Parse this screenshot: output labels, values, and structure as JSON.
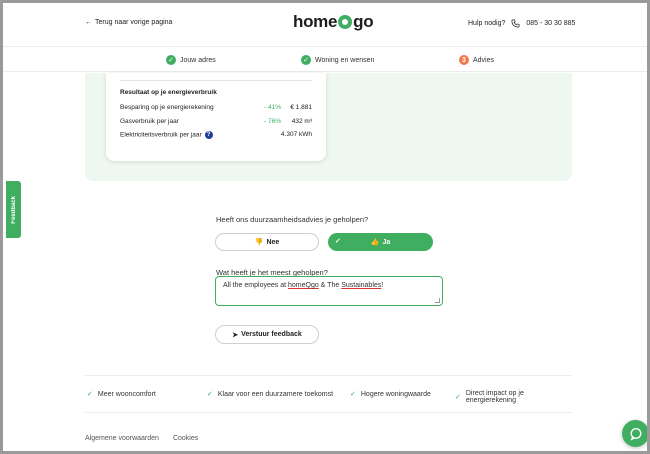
{
  "header": {
    "back_label": "Terug naar vorige pagina",
    "logo_part1": "home",
    "logo_part2": "go",
    "help_label": "Hulp nodig?",
    "phone": "085 - 30 30 885"
  },
  "steps": [
    {
      "label": "Jouw adres",
      "marker": "✓"
    },
    {
      "label": "Woning en wensen",
      "marker": "✓"
    },
    {
      "label": "Advies",
      "marker": "3"
    }
  ],
  "results": {
    "title": "Resultaat op je energieverbruik",
    "rows": [
      {
        "label": "Besparing op je energierekening",
        "pct": "- 41%",
        "value": "€ 1.881"
      },
      {
        "label": "Gasverbruik per jaar",
        "pct": "- 76%",
        "value": "432 m³"
      },
      {
        "label": "Elektriciteitsverbruik per jaar",
        "pct": "",
        "value": "4.307 kWh"
      }
    ],
    "info_glyph": "?"
  },
  "feedback_tab": "Feedback",
  "feedback": {
    "question1": "Heeft ons duurzaamheidsadvies je geholpen?",
    "no_label": "Nee",
    "yes_label": "Ja",
    "question2": "Wat heeft je het meest geholpen?",
    "answer_prefix": "All the employees at ",
    "answer_hl1": "homeQgo",
    "answer_mid": " & The ",
    "answer_hl2": "Sustainables",
    "answer_suffix": "!",
    "submit_label": "Verstuur feedback"
  },
  "benefits": [
    "Meer wooncomfort",
    "Klaar voor een duurzamere toekomst",
    "Hogere woningwaarde",
    "Direct impact op je energierekening"
  ],
  "footer": {
    "terms": "Algemene voorwaarden",
    "cookies": "Cookies"
  },
  "colors": {
    "brand_green": "#3fae60",
    "step_orange": "#f07a4a",
    "panel_green": "#eef7f0",
    "info_blue": "#1f3f9a"
  }
}
